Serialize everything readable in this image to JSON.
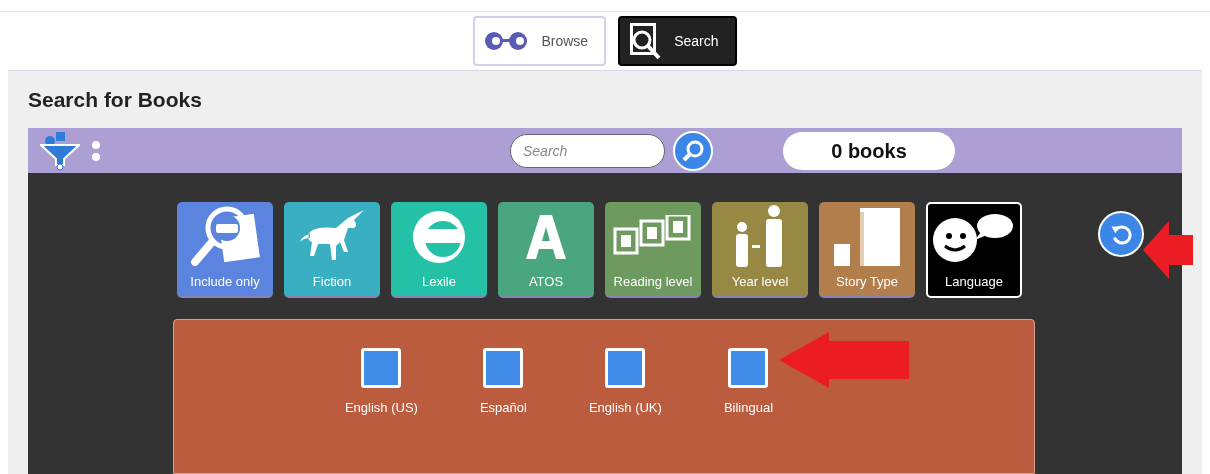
{
  "tabs": [
    {
      "label": "Browse",
      "kind": "browse",
      "selected": false
    },
    {
      "label": "Search",
      "kind": "search",
      "selected": true
    }
  ],
  "page_title": "Search for Books",
  "search": {
    "placeholder": "Search"
  },
  "result_count": "0 books",
  "filters": [
    {
      "label": "Include only",
      "kind": "include",
      "color": "#5b84de",
      "selected": false
    },
    {
      "label": "Fiction",
      "kind": "fiction",
      "color": "#3aafc2",
      "selected": false
    },
    {
      "label": "Lexile",
      "kind": "lexile",
      "color": "#24c1a6",
      "selected": false
    },
    {
      "label": "ATOS",
      "kind": "atos",
      "color": "#4aa67e",
      "selected": false
    },
    {
      "label": "Reading level",
      "kind": "reading",
      "color": "#6f9a5f",
      "selected": false
    },
    {
      "label": "Year level",
      "kind": "year",
      "color": "#978943",
      "selected": false
    },
    {
      "label": "Story Type",
      "kind": "story",
      "color": "#b17e4c",
      "selected": false
    },
    {
      "label": "Language",
      "kind": "language",
      "color": "#000000",
      "selected": true
    }
  ],
  "languages": [
    {
      "label": "English (US)",
      "checked": false
    },
    {
      "label": "Español",
      "checked": false
    },
    {
      "label": "English (UK)",
      "checked": false
    },
    {
      "label": "Bilingual",
      "checked": false
    }
  ]
}
